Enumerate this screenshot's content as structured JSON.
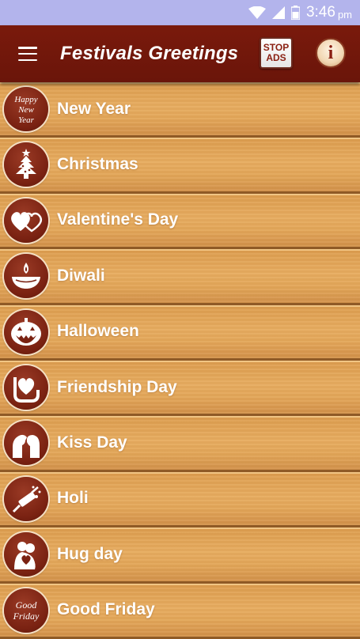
{
  "status_bar": {
    "time": "3:46",
    "ampm": "pm"
  },
  "app_bar": {
    "title": "Festivals Greetings",
    "stop_ads_line1": "STOP",
    "stop_ads_line2": "ADS",
    "info_label": "i"
  },
  "colors": {
    "app_bar": "#6a150a",
    "status_bar": "#b3b4ec",
    "wood": "#e3a658",
    "icon_bg": "#7a2212"
  },
  "festivals": [
    {
      "label": "New Year",
      "icon": "happy-new-year-icon",
      "icon_text": [
        "Happy",
        "New",
        "Year"
      ]
    },
    {
      "label": "Christmas",
      "icon": "christmas-tree-icon"
    },
    {
      "label": "Valentine's Day",
      "icon": "hearts-icon"
    },
    {
      "label": "Diwali",
      "icon": "diya-lamp-icon"
    },
    {
      "label": "Halloween",
      "icon": "pumpkin-icon"
    },
    {
      "label": "Friendship Day",
      "icon": "friendship-heart-icon"
    },
    {
      "label": "Kiss Day",
      "icon": "kiss-couple-icon"
    },
    {
      "label": "Holi",
      "icon": "holi-pichkari-icon"
    },
    {
      "label": "Hug day",
      "icon": "hug-couple-icon"
    },
    {
      "label": "Good Friday",
      "icon": "good-friday-icon",
      "icon_text": [
        "Good",
        "Friday"
      ]
    }
  ]
}
